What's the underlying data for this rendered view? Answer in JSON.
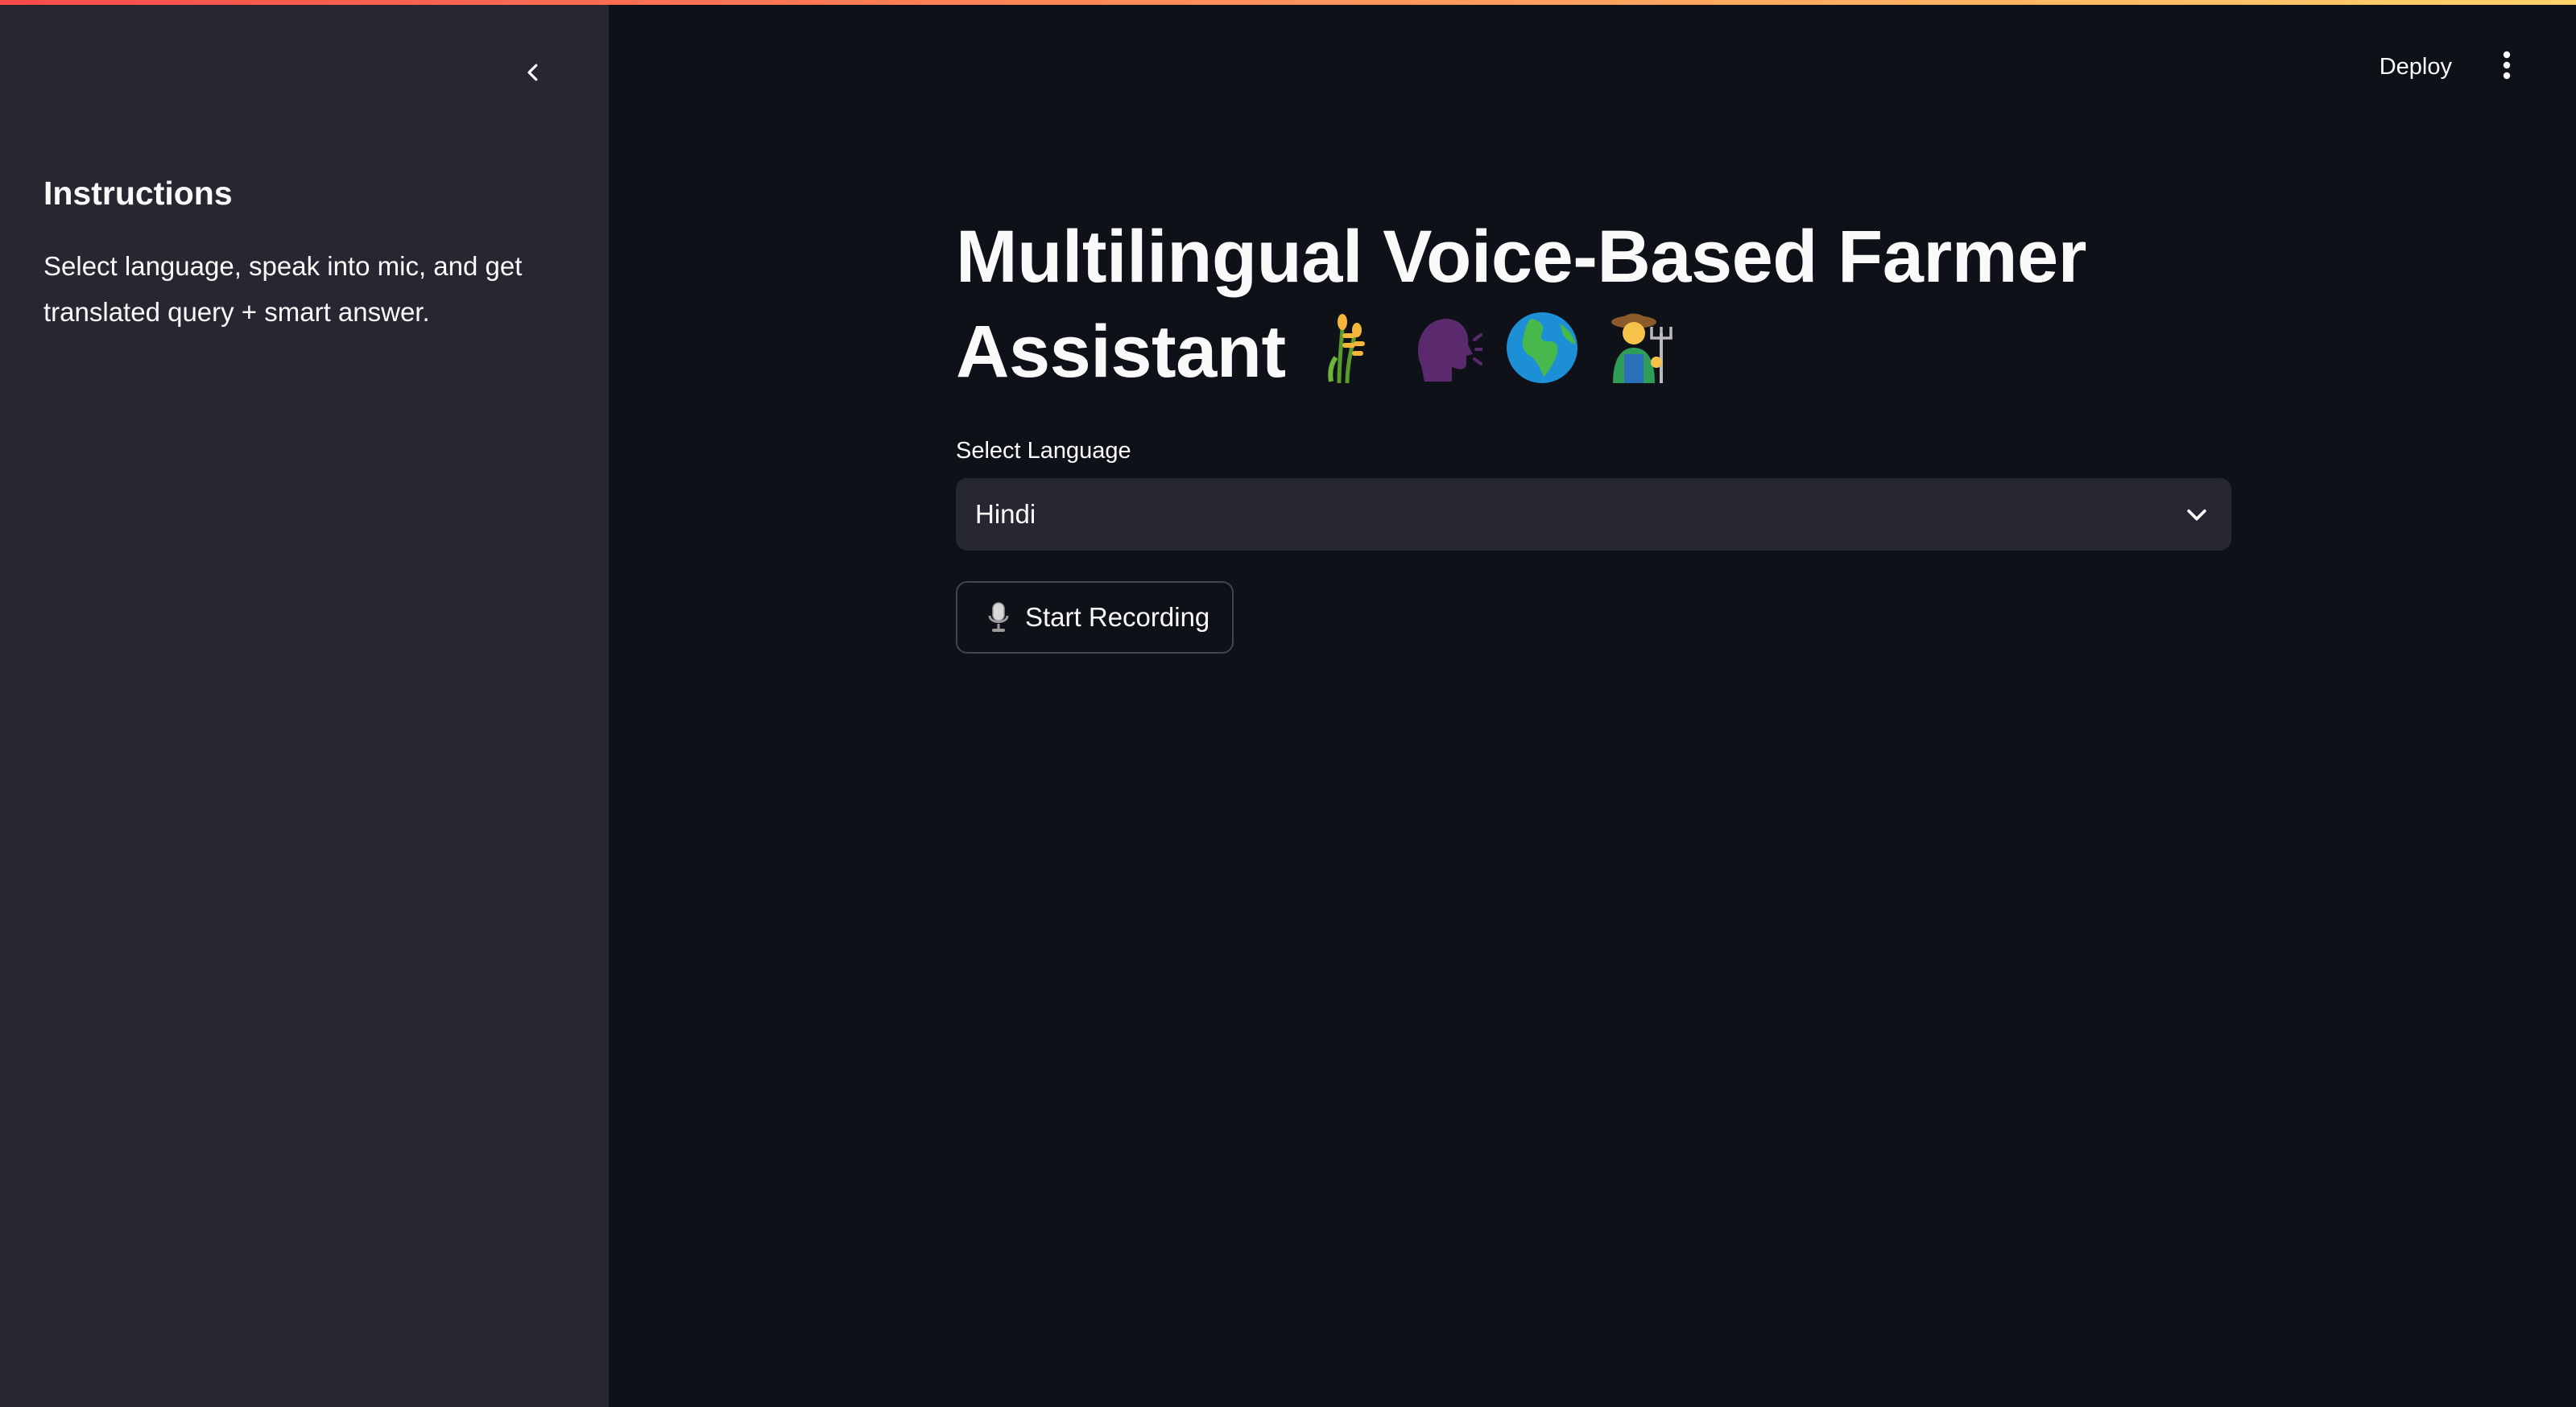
{
  "header": {
    "deploy_label": "Deploy",
    "menu_icon": "vertical-dots-icon"
  },
  "sidebar": {
    "collapse_icon": "chevron-left-icon",
    "heading": "Instructions",
    "text": "Select language, speak into mic, and get translated query + smart answer."
  },
  "main": {
    "title": "Multilingual Voice-Based Farmer Assistant",
    "title_emojis": [
      "sheaf-of-rice-icon",
      "speaking-head-icon",
      "globe-africa-europe-icon",
      "farmer-icon"
    ],
    "language": {
      "label": "Select Language",
      "selected": "Hindi"
    },
    "record_button": {
      "icon": "microphone-icon",
      "label": "Start Recording"
    }
  },
  "colors": {
    "background": "#0e1117",
    "sidebar_background": "#262730",
    "text": "#fafafa",
    "accent_gradient": [
      "#ff4b4b",
      "#ffd26a"
    ]
  }
}
